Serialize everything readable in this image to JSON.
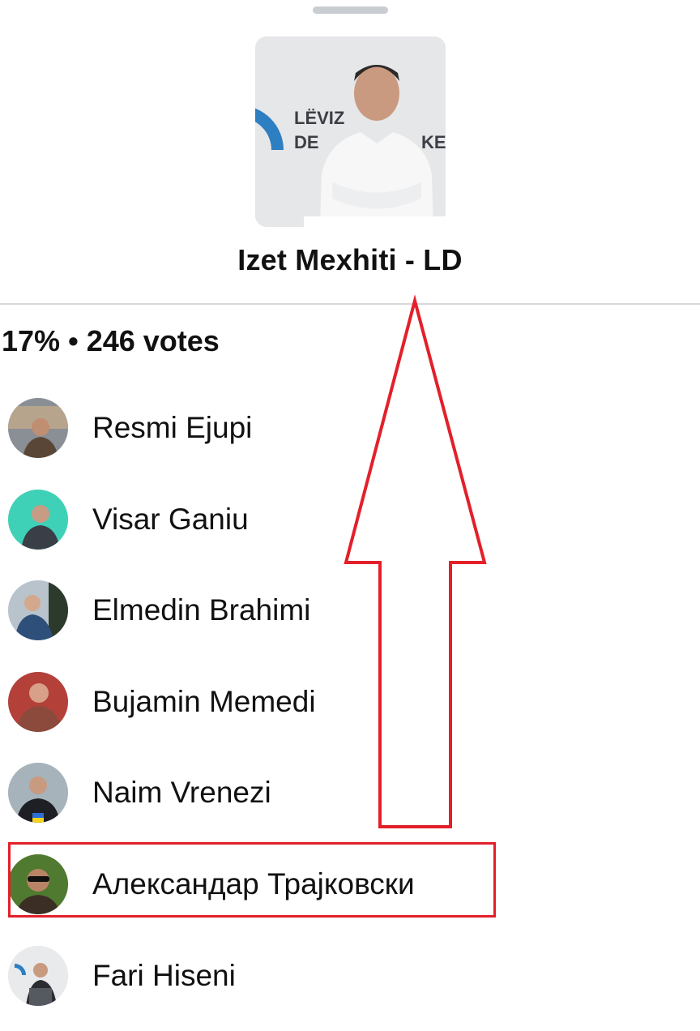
{
  "poll_option": {
    "title": "Izet Mexhiti - LD",
    "photo_sign_text": "LËVIZ DE KE",
    "percent": "17%",
    "separator": "•",
    "votes": "246 votes"
  },
  "voters": [
    {
      "name": "Resmi Ejupi",
      "avatar_colors": [
        "#8a8f96",
        "#5a4636"
      ]
    },
    {
      "name": "Visar Ganiu",
      "avatar_colors": [
        "#3fd1b8",
        "#3a3f47"
      ]
    },
    {
      "name": "Elmedin Brahimi",
      "avatar_colors": [
        "#b9c3cc",
        "#2d4f7a"
      ]
    },
    {
      "name": "Bujamin Memedi",
      "avatar_colors": [
        "#b3413a",
        "#d9a089"
      ]
    },
    {
      "name": "Naim Vrenezi",
      "avatar_colors": [
        "#a7b3ba",
        "#1d1f24"
      ]
    },
    {
      "name": "Александар Трајковски",
      "avatar_colors": [
        "#4f7a2f",
        "#3b2e25"
      ]
    },
    {
      "name": "Fari Hiseni",
      "avatar_colors": [
        "#e8eaec",
        "#2a2c30"
      ]
    }
  ],
  "annotations": {
    "arrow_color": "#e3202a",
    "highlighted_voter": "Александар Трајковски"
  }
}
